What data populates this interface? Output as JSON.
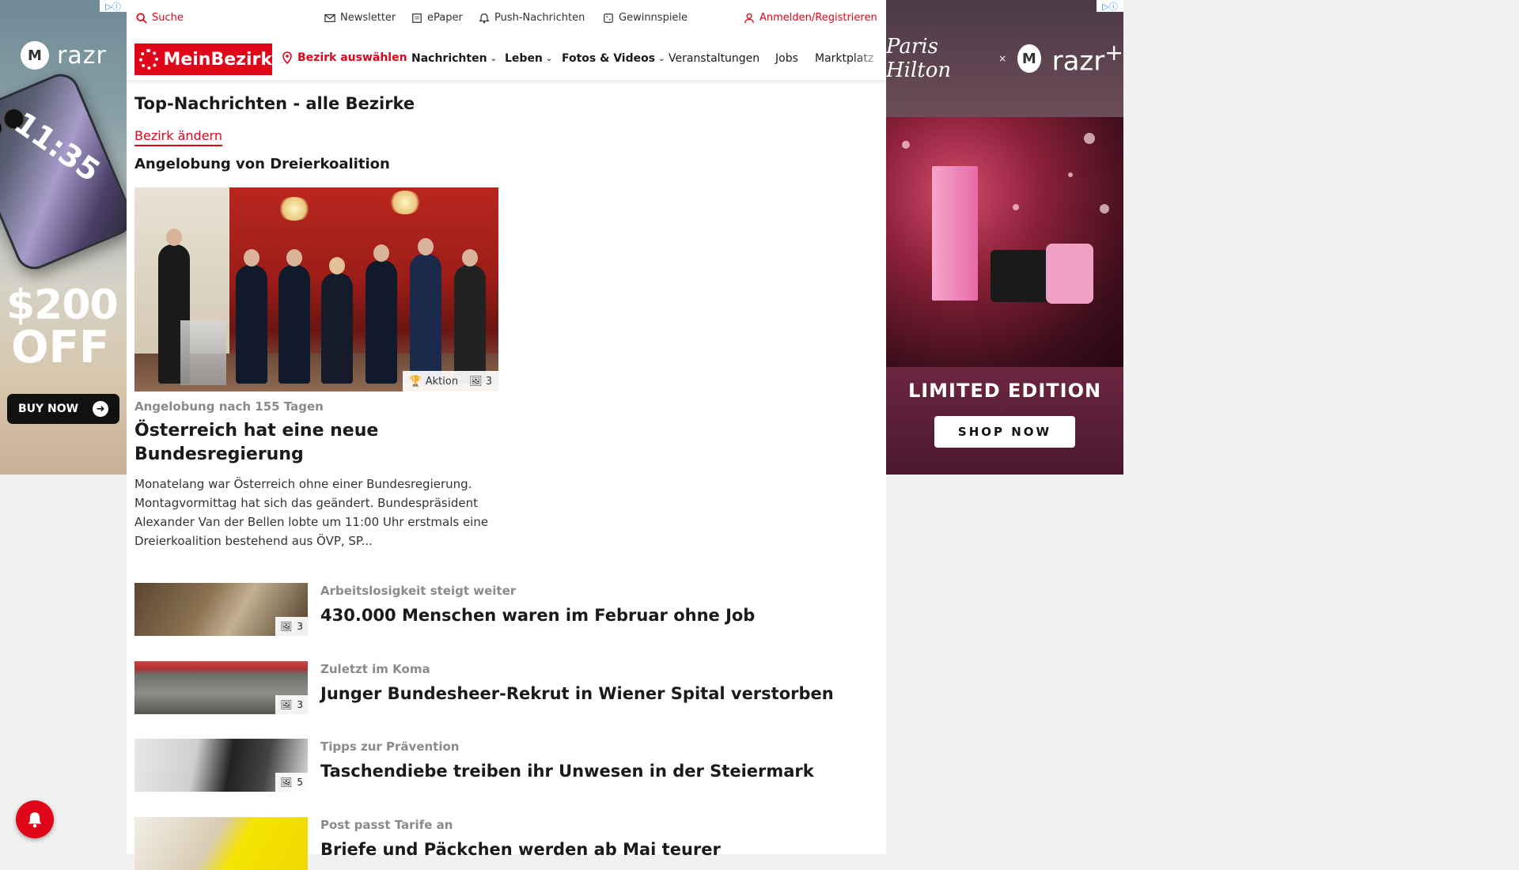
{
  "ads": {
    "left": {
      "brand": "razr",
      "offer_amount": "$200",
      "offer_word": "OFF",
      "cta": "BUY NOW",
      "phone_time": "11:35"
    },
    "right": {
      "brand": "razr",
      "brand_sup": "+",
      "x": "×",
      "edition": "LIMITED EDITION",
      "cta": "SHOP NOW"
    }
  },
  "utility": {
    "search": "Suche",
    "newsletter": "Newsletter",
    "epaper": "ePaper",
    "push": "Push-Nachrichten",
    "contests": "Gewinnspiele",
    "login": "Anmelden/Registrieren"
  },
  "nav": {
    "logo": "MeinBezirk",
    "pick": "Bezirk auswählen",
    "items": [
      "Nachrichten",
      "Leben",
      "Fotos & Videos",
      "Veranstaltungen",
      "Jobs",
      "Marktplatz"
    ]
  },
  "page": {
    "title": "Top-Nachrichten - alle Bezirke",
    "change": "Bezirk ändern",
    "section": "Angelobung von Dreierkoalition"
  },
  "hero": {
    "badge_label": "Aktion",
    "badge_count": "3",
    "kicker": "Angelobung nach 155 Tagen",
    "headline": "Österreich hat eine neue Bundesregierung",
    "text": "Monatelang war Österreich ohne einer Bundesregierung. Montagvormittag hat sich das geändert. Bundespräsident Alexander Van der Bellen lobte um 11:00 Uhr erstmals eine Dreierkoalition bestehend aus ÖVP, SP..."
  },
  "articles": [
    {
      "kicker": "Arbeitslosigkeit steigt weiter",
      "headline": "430.000 Menschen waren im Februar ohne Job",
      "count": "3"
    },
    {
      "kicker": "Zuletzt im Koma",
      "headline": "Junger Bundesheer-Rekrut in Wiener Spital verstorben",
      "count": "3"
    },
    {
      "kicker": "Tipps zur Prävention",
      "headline": "Taschendiebe treiben ihr Unwesen in der Steiermark",
      "count": "5"
    },
    {
      "kicker": "Post passt Tarife an",
      "headline": "Briefe und Päckchen werden ab Mai teurer",
      "count": ""
    }
  ],
  "colors": {
    "accent": "#e0061a"
  }
}
